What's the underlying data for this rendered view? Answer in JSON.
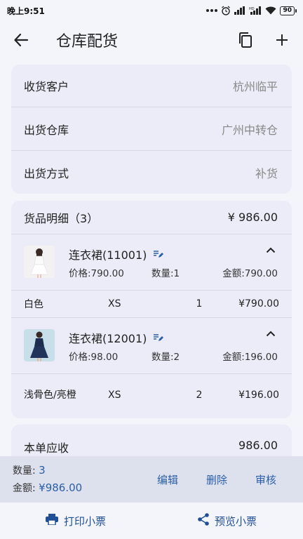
{
  "status": {
    "time": "晚上9:51",
    "signal": "HD",
    "battery": "90"
  },
  "app_bar": {
    "title": "仓库配货"
  },
  "info": {
    "customer_label": "收货客户",
    "customer_value": "杭州临平",
    "warehouse_label": "出货仓库",
    "warehouse_value": "广州中转仓",
    "method_label": "出货方式",
    "method_value": "补货"
  },
  "detail": {
    "header_label": "货品明细（3）",
    "header_total": "¥ 986.00",
    "items": [
      {
        "name": "连衣裙(11001)",
        "price": "价格:790.00",
        "qty": "数量:1",
        "amount": "金额:790.00",
        "variants": [
          {
            "color": "白色",
            "size": "XS",
            "qty": "1",
            "amount": "¥790.00"
          }
        ]
      },
      {
        "name": "连衣裙(12001)",
        "price": "价格:98.00",
        "qty": "数量:2",
        "amount": "金额:196.00",
        "variants": [
          {
            "color": "浅骨色/亮橙",
            "size": "XS",
            "qty": "2",
            "amount": "¥196.00"
          }
        ]
      }
    ]
  },
  "receivable": {
    "label": "本单应收",
    "value": "986.00"
  },
  "summary": {
    "qty_label": "数量:",
    "qty_value": "3",
    "amount_label": "金额:",
    "amount_value": "¥986.00",
    "edit": "编辑",
    "delete": "删除",
    "audit": "审核"
  },
  "bottom": {
    "print": "打印小票",
    "preview": "预览小票"
  },
  "colors": {
    "accent": "#2a5ea8",
    "card": "#ececf8"
  }
}
